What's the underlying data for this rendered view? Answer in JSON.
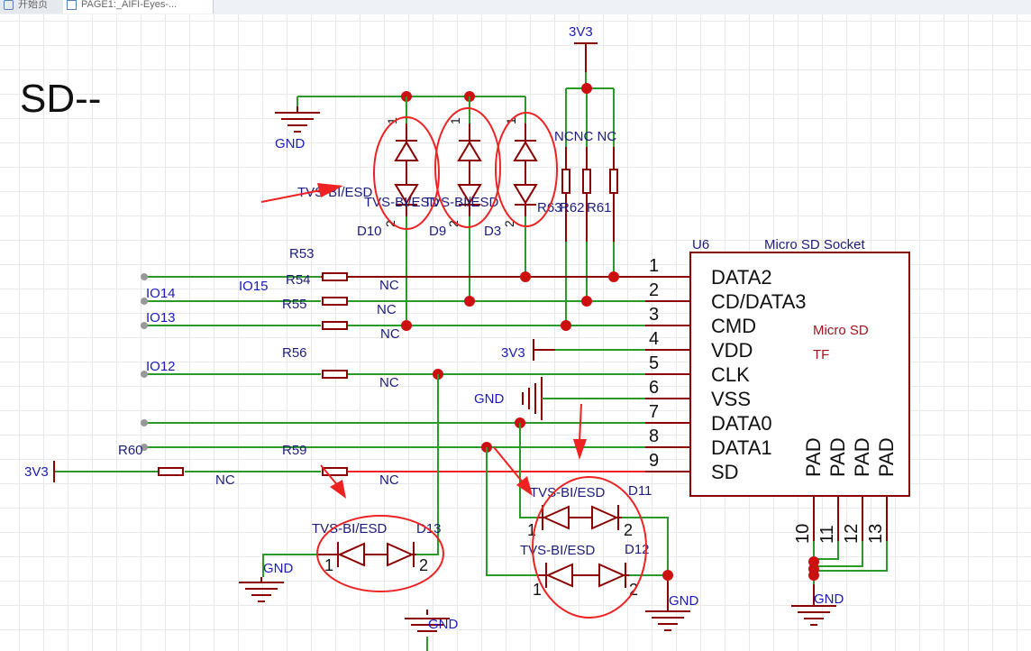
{
  "tabs": [
    {
      "label": "开始页"
    },
    {
      "label": "PAGE1:_AIFI-Eyes-..."
    }
  ],
  "title": "SD--",
  "power": {
    "v33": "3V3",
    "gnd": "GND"
  },
  "connector": {
    "ref": "U6",
    "name": "Micro SD Socket",
    "pins": [
      {
        "num": "1",
        "name": "DATA2"
      },
      {
        "num": "2",
        "name": "CD/DATA3"
      },
      {
        "num": "3",
        "name": "CMD"
      },
      {
        "num": "4",
        "name": "VDD"
      },
      {
        "num": "5",
        "name": "CLK"
      },
      {
        "num": "6",
        "name": "VSS"
      },
      {
        "num": "7",
        "name": "DATA0"
      },
      {
        "num": "8",
        "name": "DATA1"
      },
      {
        "num": "9",
        "name": "SD"
      }
    ],
    "pads": [
      {
        "num": "10",
        "name": "PAD"
      },
      {
        "num": "11",
        "name": "PAD"
      },
      {
        "num": "12",
        "name": "PAD"
      },
      {
        "num": "13",
        "name": "PAD"
      }
    ],
    "note1": "Micro SD",
    "note2": "TF"
  },
  "nets": {
    "io15": "IO15",
    "io14": "IO14",
    "io13": "IO13",
    "io12": "IO12"
  },
  "resistors": {
    "r53": "R53",
    "r54": "R54",
    "r55": "R55",
    "r56": "R56",
    "r59": "R59",
    "r60": "R60",
    "r61": "R61",
    "r62": "R62",
    "r63": "R63",
    "value": "NC",
    "pullups": "NCNC NC"
  },
  "diodes": {
    "type": "TVS-BI/ESD",
    "d10": "D10",
    "d9": "D9",
    "d3": "D3",
    "d11": "D11",
    "d12": "D12",
    "d13": "D13",
    "pin1": "1",
    "pin2": "2"
  }
}
